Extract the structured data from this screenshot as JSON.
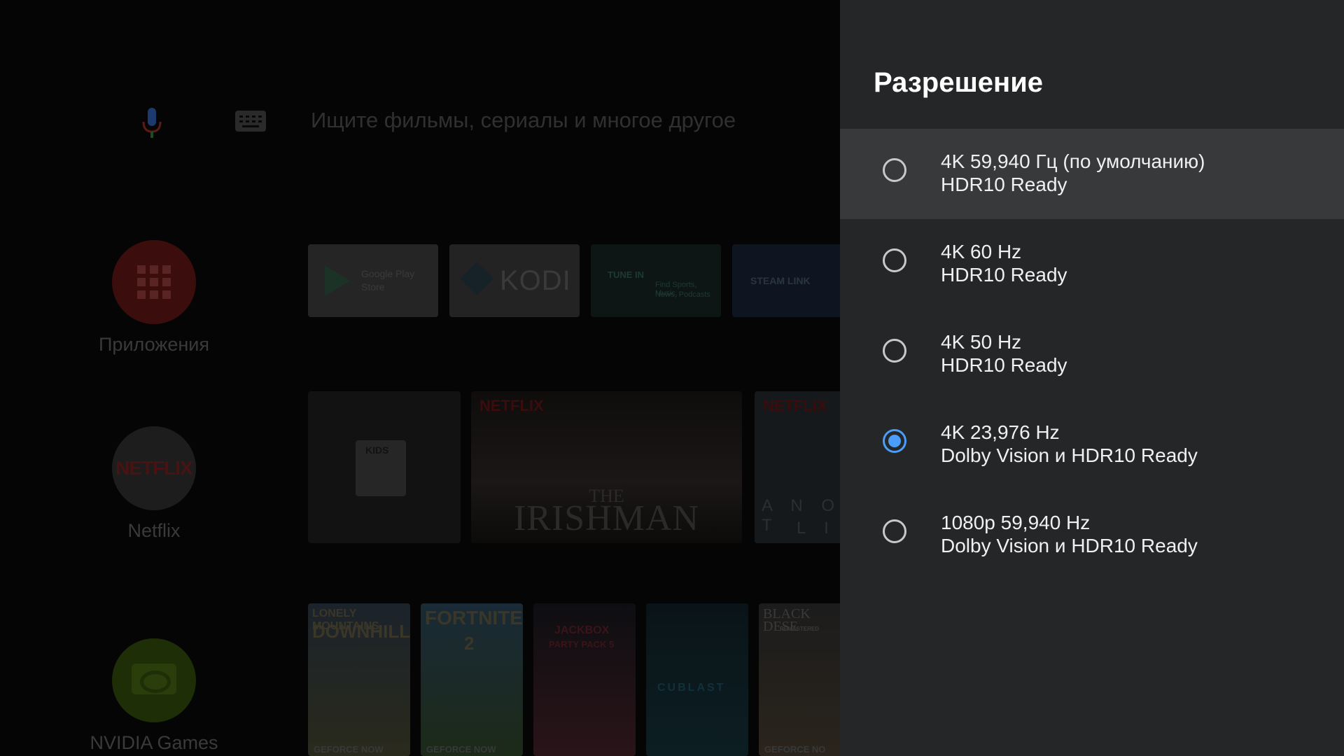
{
  "search": {
    "placeholder": "Ищите фильмы, сериалы и многое другое"
  },
  "sidebar": {
    "items": [
      {
        "label": "Приложения",
        "icon": "apps-grid-icon"
      },
      {
        "label": "Netflix",
        "icon": "netflix-icon",
        "logo_text": "NETFLIX"
      },
      {
        "label": "NVIDIA Games",
        "icon": "nvidia-icon"
      }
    ]
  },
  "app_row": [
    {
      "name": "Google Play Store",
      "line1": "Google Play",
      "line2": "Store"
    },
    {
      "name": "KODI",
      "logo": "KODI"
    },
    {
      "name": "TuneIn",
      "logo": "TUNE IN",
      "line1": "Find Sports, Music,",
      "line2": "News, Podcasts"
    },
    {
      "name": "Steam Link",
      "logo": "STEAM LINK"
    }
  ],
  "movie_row": [
    {
      "badge": "KIDS"
    },
    {
      "badge": "NETFLIX",
      "the": "THE",
      "title": "IRISHMAN"
    },
    {
      "badge": "NETFLIX",
      "title": "A N O T",
      "sub": "L I"
    }
  ],
  "game_row": [
    {
      "title": "LONELY MOUNTAINS",
      "title2": "DOWNHILL",
      "footer": "GEFORCE NOW"
    },
    {
      "title": "FORTNITE",
      "title2": "2",
      "footer": "GEFORCE NOW"
    },
    {
      "title": "JACKBOX",
      "title2": "PARTY PACK 5",
      "footer": ""
    },
    {
      "title": "CUBLAST",
      "title2": "",
      "footer": ""
    },
    {
      "title": "BLACK DESE",
      "title2": "REMASTERED",
      "footer": "GEFORCE NO"
    }
  ],
  "panel": {
    "title": "Разрешение",
    "accent_color": "#4a9df8",
    "options": [
      {
        "line1": "4K 59,940 Гц (по умолчанию)",
        "line2": "HDR10 Ready",
        "selected": false,
        "focused": true
      },
      {
        "line1": "4K 60 Hz",
        "line2": "HDR10 Ready",
        "selected": false,
        "focused": false
      },
      {
        "line1": "4K 50 Hz",
        "line2": "HDR10 Ready",
        "selected": false,
        "focused": false
      },
      {
        "line1": "4K 23,976 Hz",
        "line2": "Dolby Vision и HDR10 Ready",
        "selected": true,
        "focused": false
      },
      {
        "line1": "1080p 59,940 Hz",
        "line2": "Dolby Vision и HDR10 Ready",
        "selected": false,
        "focused": false
      }
    ]
  }
}
